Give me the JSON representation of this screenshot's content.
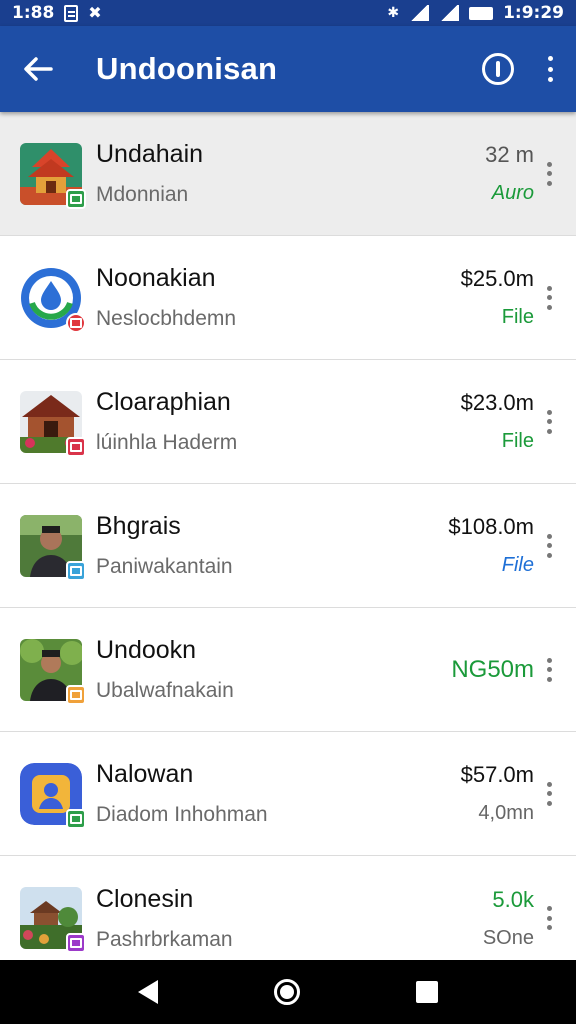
{
  "status_bar": {
    "time_left": "1:88",
    "time_right": "1:9:29"
  },
  "app_bar": {
    "title": "Undoonisan",
    "icons": [
      "back-arrow-icon",
      "filter-icon",
      "more-vert-icon"
    ]
  },
  "colors": {
    "app_bar": "#1e4ea6",
    "status_bar": "#1a3f8f",
    "green": "#1b9a3a",
    "blue": "#1e6fd6"
  },
  "rows": [
    {
      "title": "Undahain",
      "subtitle": "Mdonnian",
      "amount": "32 m",
      "status": "Auro",
      "icon": "temple-thumbnail",
      "badge_color": "#2e9e4a"
    },
    {
      "title": "Noonakian",
      "subtitle": "Neslocbhdemn",
      "amount": "$25.0m",
      "status": "File",
      "icon": "droplet-app-icon",
      "badge_color": "#e0383e"
    },
    {
      "title": "Cloaraphian",
      "subtitle": "lúinhla Haderm",
      "amount": "$23.0m",
      "status": "File",
      "icon": "house-thumbnail",
      "badge_color": "#d9344a"
    },
    {
      "title": "Bhgrais",
      "subtitle": "Paniwakantain",
      "amount": "$108.0m",
      "status": "File",
      "icon": "person-thumbnail",
      "badge_color": "#3aa3d9"
    },
    {
      "title": "Undookn",
      "subtitle": "Ubalwafnakain",
      "amount": "NG50m",
      "status": "",
      "icon": "person-garden-thumbnail",
      "badge_color": "#f0a13a"
    },
    {
      "title": "Nalowan",
      "subtitle": "Diadom Inhohman",
      "amount": "$57.0m",
      "status": "4,0mn",
      "icon": "contacts-app-icon",
      "badge_color": "#2e9e4a"
    },
    {
      "title": "Clonesin",
      "subtitle": "Pashrbrkaman",
      "amount": "5.0k",
      "status": "SOne",
      "icon": "landscape-thumbnail",
      "badge_color": "#9c3ac9"
    }
  ]
}
